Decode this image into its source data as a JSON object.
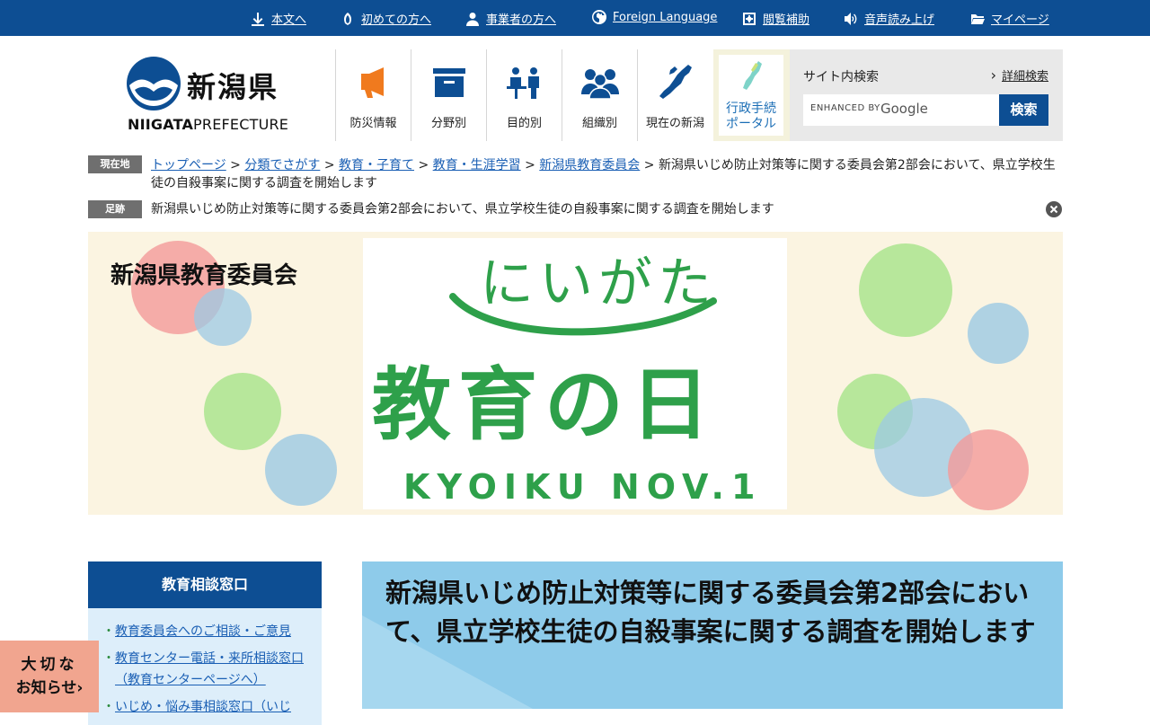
{
  "utility_nav": [
    {
      "label": "本文へ",
      "icon": "down-arrow-icon"
    },
    {
      "label": "初めての方へ",
      "icon": "leaf-icon"
    },
    {
      "label": "事業者の方へ",
      "icon": "person-icon"
    },
    {
      "label": "Foreign Language",
      "icon": "globe-icon"
    },
    {
      "label": "閲覧補助",
      "icon": "gear-icon"
    },
    {
      "label": "音声読み上げ",
      "icon": "speaker-icon"
    },
    {
      "label": "マイページ",
      "icon": "folder-icon"
    }
  ],
  "logo": {
    "jp": "新潟県",
    "en_bold": "NIIGATA",
    "en_light": "PREFECTURE"
  },
  "main_nav": [
    {
      "label": "防災情報",
      "icon": "megaphone-icon"
    },
    {
      "label": "分野別",
      "icon": "box-icon"
    },
    {
      "label": "目的別",
      "icon": "people-desk-icon"
    },
    {
      "label": "組織別",
      "icon": "group-icon"
    },
    {
      "label": "現在の新潟",
      "icon": "niigata-map-icon"
    }
  ],
  "portal": {
    "line1": "行政手続",
    "line2": "ポータル"
  },
  "search": {
    "title": "サイト内検索",
    "advanced": "詳細検索",
    "placeholder": "ENHANCED BY",
    "brand": "Google",
    "button": "検索"
  },
  "breadcrumb": {
    "tag": "現在地",
    "links": [
      "トップページ",
      "分類でさがす",
      "教育・子育て",
      "教育・生涯学習",
      "新潟県教育委員会"
    ],
    "current": "新潟県いじめ防止対策等に関する委員会第2部会において、県立学校生徒の自殺事案に関する調査を開始します"
  },
  "footprint": {
    "tag": "足跡",
    "text": "新潟県いじめ防止対策等に関する委員会第2部会において、県立学校生徒の自殺事案に関する調査を開始します"
  },
  "banner": {
    "title": "新潟県教育委員会",
    "art_line1": "にいがた",
    "art_line2": "教育の日",
    "art_line3": "KYOIKU NOV.1"
  },
  "sidebar": {
    "heading": "教育相談窓口",
    "items": [
      "教育委員会へのご相談・ご意見",
      "教育センター電話・来所相談窓口（教育センターページへ）",
      "いじめ・悩み事相談窓口（いじ"
    ]
  },
  "notice": {
    "line1": "大切な",
    "line2": "お知らせ"
  },
  "page_title": "新潟県いじめ防止対策等に関する委員会第2部会において、県立学校生徒の自殺事案に関する調査を開始します",
  "colors": {
    "brand_blue": "#0d4e93",
    "title_bg": "#8ecbea",
    "side_bg": "#ddeefa",
    "notice_bg": "#f1a58f",
    "banner_green": "#2ea04a"
  }
}
